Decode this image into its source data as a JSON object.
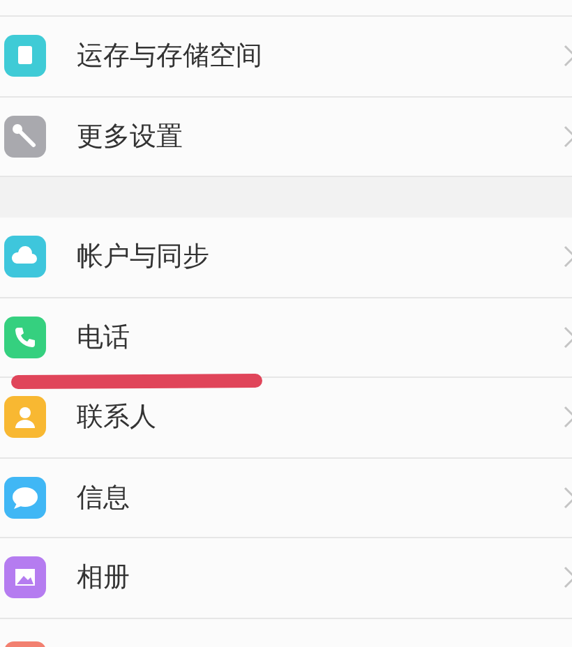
{
  "sections": [
    {
      "items": [
        {
          "kind": "storage",
          "label": "运存与存储空间"
        },
        {
          "kind": "wrench",
          "label": "更多设置"
        }
      ]
    },
    {
      "items": [
        {
          "kind": "cloud",
          "label": "帐户与同步"
        },
        {
          "kind": "phone",
          "label": "电话"
        },
        {
          "kind": "contact",
          "label": "联系人"
        },
        {
          "kind": "message",
          "label": "信息"
        },
        {
          "kind": "photo",
          "label": "相册"
        },
        {
          "kind": "partial"
        }
      ]
    }
  ]
}
